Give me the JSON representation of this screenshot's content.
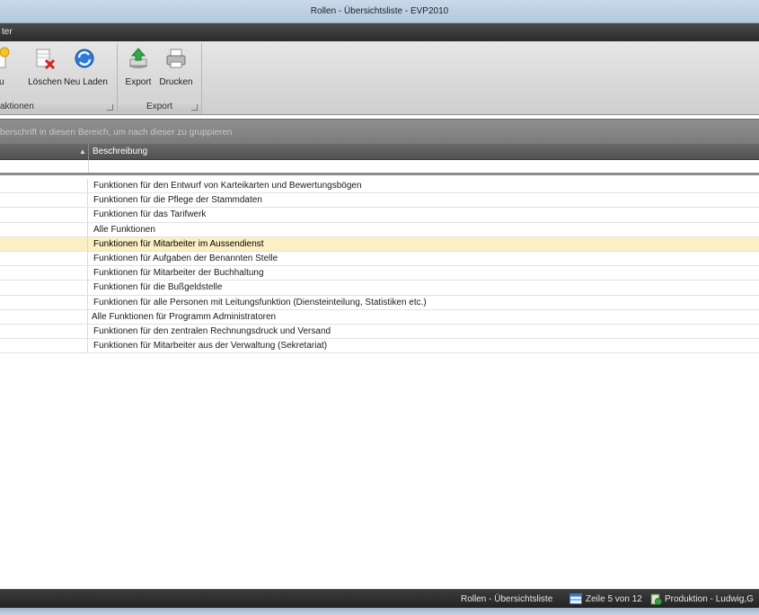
{
  "window": {
    "title": "Rollen - Übersichtsliste - EVP2010"
  },
  "ribbon": {
    "tab_label": "ter",
    "groups": [
      {
        "title": "aktionen",
        "buttons": [
          {
            "label": "eu",
            "icon": "new-document-icon"
          },
          {
            "label": "Löschen",
            "icon": "delete-icon"
          },
          {
            "label": "Neu Laden",
            "icon": "refresh-icon"
          }
        ]
      },
      {
        "title": "Export",
        "buttons": [
          {
            "label": "Export",
            "icon": "export-icon"
          },
          {
            "label": "Drucken",
            "icon": "print-icon"
          }
        ]
      }
    ]
  },
  "grid": {
    "group_hint": "berschrift in diesen Bereich, um nach dieser zu gruppieren",
    "column_header": "Beschreibung",
    "selected_index": 4,
    "rows": [
      "Funktionen für den Entwurf von Karteikarten und Bewertungsbögen",
      "Funktionen für die Pflege der Stammdaten",
      "Funktionen für das Tarifwerk",
      "Alle Funktionen",
      "Funktionen für Mitarbeiter im Aussendienst",
      "Funktionen für Aufgaben der Benannten Stelle",
      "Funktionen für Mitarbeiter der Buchhaltung",
      "Funktionen für die Bußgeldstelle",
      "Funktionen für alle Personen mit Leitungsfunktion (Diensteinteilung, Statistiken etc.)",
      "Alle Funktionen für Programm Administratoren",
      "Funktionen für den zentralen Rechnungsdruck und Versand",
      "Funktionen für Mitarbeiter aus der Verwaltung (Sekretariat)"
    ]
  },
  "status": {
    "view_name": "Rollen - Übersichtsliste",
    "row_info": "Zeile 5 von 12",
    "environment": "Produktion - Ludwig,G"
  }
}
